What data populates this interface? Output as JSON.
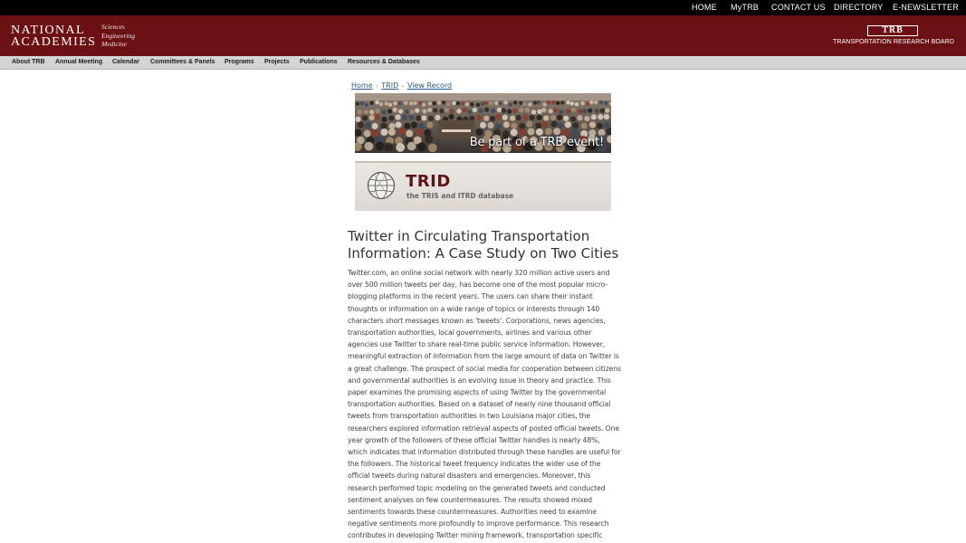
{
  "topbar": {
    "links": [
      "HOME",
      "MyTRB",
      "CONTACT US",
      "DIRECTORY",
      "E-NEWSLETTER"
    ]
  },
  "header": {
    "logo_line1": "NATIONAL",
    "logo_line2": "ACADEMIES",
    "logo_sub": [
      "Sciences",
      "Engineering",
      "Medicine"
    ],
    "trb_mark": "TRB",
    "trb_name": "TRANSPORTATION RESEARCH BOARD"
  },
  "nav": {
    "items": [
      "About TRB",
      "Annual Meeting",
      "Calendar",
      "Committees & Panels",
      "Programs",
      "Projects",
      "Publications",
      "Resources & Databases"
    ]
  },
  "breadcrumb": {
    "home": "Home",
    "trid": "TRID",
    "current": "View Record",
    "separator": "»"
  },
  "event_banner": {
    "tagline": "Be part of a TRB event!"
  },
  "trid_box": {
    "title": "TRID",
    "subtitle": "the TRIS and ITRD database"
  },
  "article": {
    "title": "Twitter in Circulating Transportation Information: A Case Study on Two Cities",
    "abstract": "Twitter.com, an online social network with nearly 320 million active users and over 500 million tweets per day, has become one of the most popular micro-blogging platforms in the recent years. The users can share their instant thoughts or information on a wide range of topics or interests through 140 characters short messages known as 'tweets'. Corporations, news agencies, transportation authorities, local governments, airlines and various other agencies use Twitter to share real-time public service information. However, meaningful extraction of information from the large amount of data on Twitter is a great challenge. The prospect of social media for cooperation between citizens and governmental authorities is an evolving issue in theory and practice. This paper examines the promising aspects of using Twitter by the governmental transportation authorities. Based on a dataset of nearly nine thousand official tweets from transportation authorities in two Louisiana major cities, the researchers explored information retrieval aspects of posted official tweets. One year growth of the followers of these official Twitter handles is nearly 48%, which indicates that information distributed through these handles are useful for the followers. The historical tweet frequency indicates the wider use of the official tweets during natural disasters and emergencies. Moreover, this research performed topic modeling on the generated tweets and conducted sentiment analyses on few countermeasures. The results showed mixed sentiments towards these countermeasures. Authorities need to examine negative sentiments more profoundly to improve performance. This research contributes in developing Twitter mining framework, transportation specific senti-lexicon and sentiment score algorithm."
  }
}
